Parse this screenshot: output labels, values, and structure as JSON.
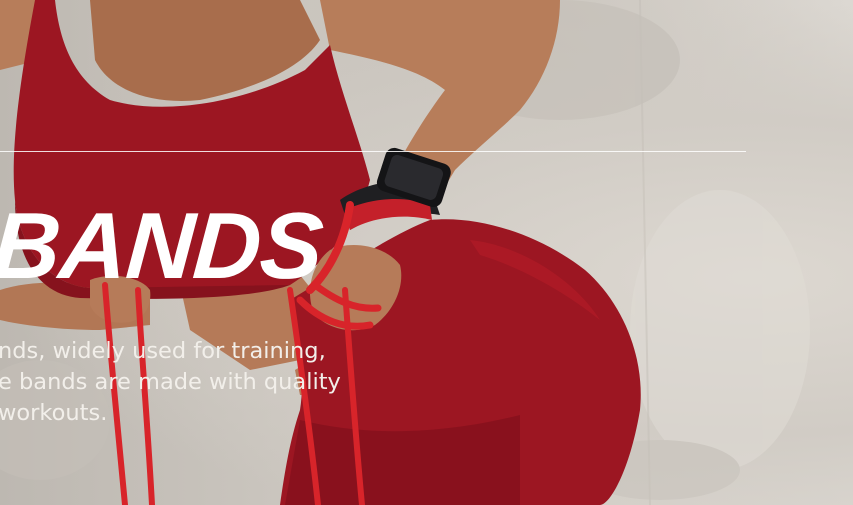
{
  "hero": {
    "headline": "E BANDS",
    "description_lines": [
      "nds, widely used for training,",
      "e bands are made with quality",
      "workouts."
    ]
  },
  "colors": {
    "garment_red": "#9c1622",
    "band_red": "#d8242a",
    "skin": "#b77d5a",
    "wall": "#cfcac3",
    "text": "#ffffff"
  },
  "icons": {
    "watch": "smartwatch-icon"
  }
}
